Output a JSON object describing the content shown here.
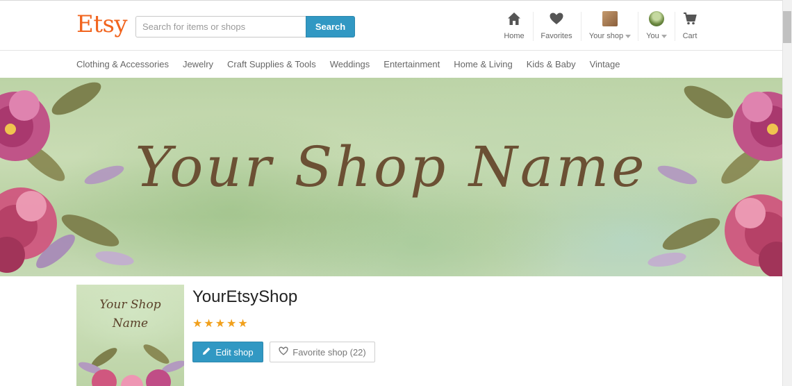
{
  "header": {
    "logo": "Etsy",
    "search": {
      "placeholder": "Search for items or shops",
      "value": "",
      "button_label": "Search"
    },
    "nav": {
      "home": "Home",
      "favorites": "Favorites",
      "your_shop": "Your shop",
      "you": "You",
      "cart": "Cart"
    }
  },
  "categories": [
    "Clothing & Accessories",
    "Jewelry",
    "Craft Supplies & Tools",
    "Weddings",
    "Entertainment",
    "Home & Living",
    "Kids & Baby",
    "Vintage"
  ],
  "banner": {
    "title": "Your Shop Name"
  },
  "shop": {
    "icon_title_line1": "Your Shop",
    "icon_title_line2": "Name",
    "name": "YourEtsyShop",
    "rating": 5,
    "edit_label": "Edit shop",
    "favorite_label": "Favorite shop (22)"
  },
  "colors": {
    "brand": "#f1641e",
    "accent": "#3198c3",
    "star": "#f1a01c",
    "script_text": "#6b5034"
  },
  "icons": [
    "home-icon",
    "heart-icon",
    "shop-thumbnail",
    "user-avatar",
    "cart-icon",
    "pencil-icon",
    "heart-outline-icon",
    "star-icon"
  ]
}
